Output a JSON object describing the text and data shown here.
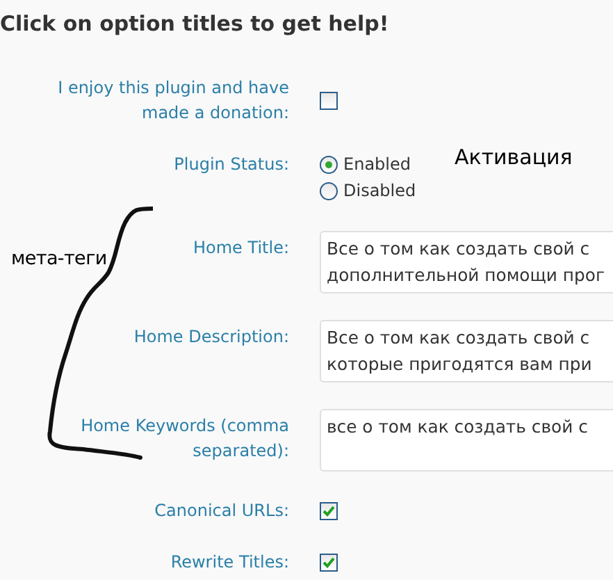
{
  "heading": "Click on option titles to get help!",
  "options": [
    {
      "kind": "checkbox",
      "label": "I enjoy this plugin and have made a donation:",
      "checked": false
    },
    {
      "kind": "radio",
      "label": "Plugin Status:",
      "choices": [
        {
          "label": "Enabled",
          "selected": true
        },
        {
          "label": "Disabled",
          "selected": false
        }
      ]
    },
    {
      "kind": "textarea",
      "label": "Home Title:",
      "value": "Все о том как создать свой с\nдополнительной помощи прог"
    },
    {
      "kind": "textarea",
      "label": "Home Description:",
      "value": "Все о том как создать свой с\nкоторые пригодятся вам при"
    },
    {
      "kind": "textarea",
      "label": "Home Keywords (comma separated):",
      "value": "все о том как создать свой с"
    },
    {
      "kind": "checkbox",
      "label": "Canonical URLs:",
      "checked": true
    },
    {
      "kind": "checkbox",
      "label": "Rewrite Titles:",
      "checked": true
    }
  ],
  "annotations": [
    {
      "text": "Активация"
    },
    {
      "text": "мета-теги"
    }
  ]
}
